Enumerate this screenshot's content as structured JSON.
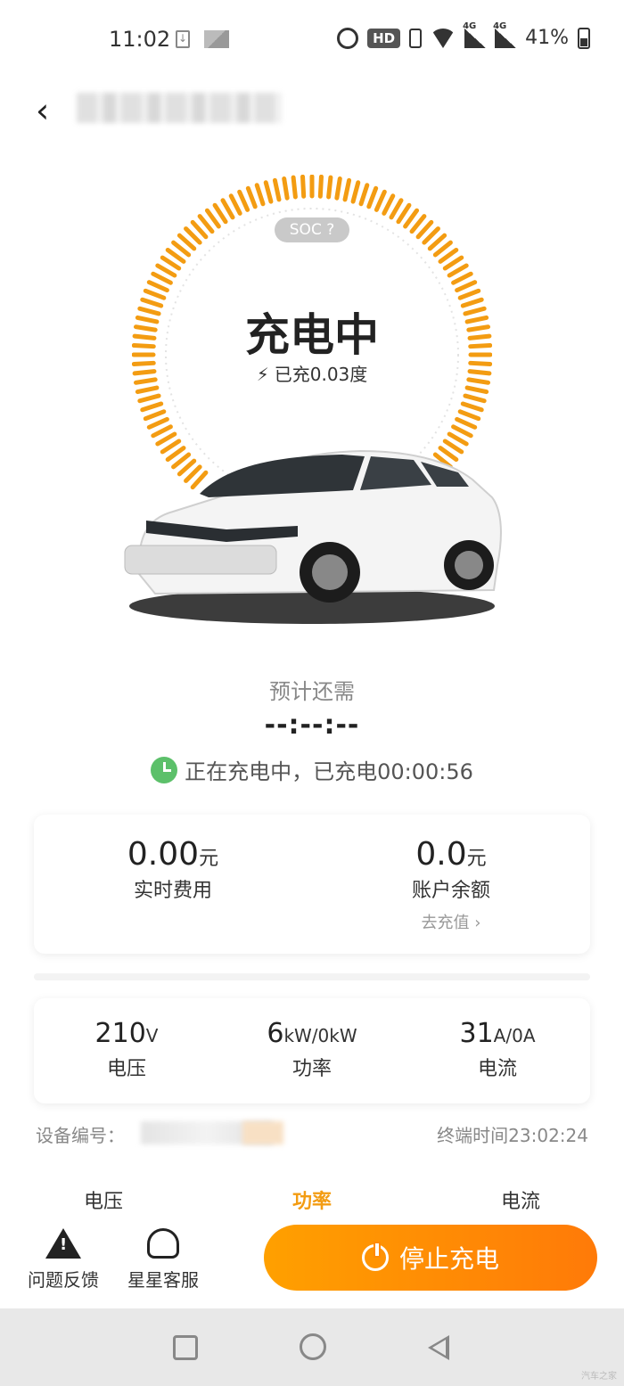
{
  "status_bar": {
    "time": "11:02",
    "hd_label": "HD",
    "battery": "41%"
  },
  "header": {
    "back_icon": "chevron-left-icon"
  },
  "charge_ring": {
    "soc_label": "SOC ?",
    "status": "充电中",
    "charged_amount": "已充0.03度",
    "ring_color": "#f39c12"
  },
  "estimate": {
    "label": "预计还需",
    "value": "--:--:--",
    "charging_status": "正在充电中，已充电00:00:56"
  },
  "fees": {
    "realtime_value": "0.00",
    "realtime_unit": "元",
    "realtime_label": "实时费用",
    "balance_value": "0.0",
    "balance_unit": "元",
    "balance_label": "账户余额",
    "topup_label": "去充值 ›"
  },
  "electrical": {
    "voltage_value": "210",
    "voltage_unit": "V",
    "voltage_label": "电压",
    "power_value": "6",
    "power_unit": "kW/0kW",
    "power_label": "功率",
    "current_value": "31",
    "current_unit": "A/0A",
    "current_label": "电流"
  },
  "device": {
    "id_label": "设备编号：",
    "terminal_time": "终端时间23:02:24"
  },
  "tabs": [
    {
      "label": "电压"
    },
    {
      "label": "功率"
    },
    {
      "label": "电流"
    }
  ],
  "bottom": {
    "feedback_label": "问题反馈",
    "service_label": "星星客服",
    "stop_label": "停止充电",
    "accent": "#ff8c00"
  },
  "watermark": "汽车之家"
}
